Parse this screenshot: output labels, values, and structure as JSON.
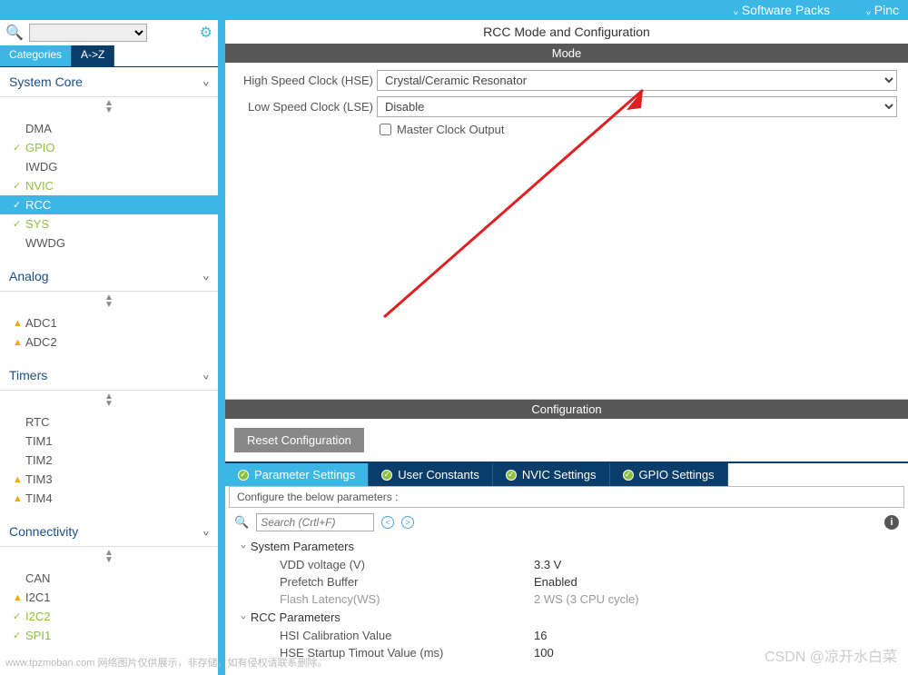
{
  "topbar": {
    "item1": "Software Packs",
    "item2": "Pinc"
  },
  "leftTabs": {
    "categories": "Categories",
    "az": "A->Z"
  },
  "search": {
    "placeholder": ""
  },
  "groups": [
    {
      "name": "System Core",
      "items": [
        {
          "label": "DMA",
          "state": ""
        },
        {
          "label": "GPIO",
          "state": "green"
        },
        {
          "label": "IWDG",
          "state": ""
        },
        {
          "label": "NVIC",
          "state": "green"
        },
        {
          "label": "RCC",
          "state": "green",
          "selected": true
        },
        {
          "label": "SYS",
          "state": "green"
        },
        {
          "label": "WWDG",
          "state": ""
        }
      ]
    },
    {
      "name": "Analog",
      "items": [
        {
          "label": "ADC1",
          "state": "warn"
        },
        {
          "label": "ADC2",
          "state": "warn"
        }
      ]
    },
    {
      "name": "Timers",
      "items": [
        {
          "label": "RTC",
          "state": ""
        },
        {
          "label": "TIM1",
          "state": ""
        },
        {
          "label": "TIM2",
          "state": ""
        },
        {
          "label": "TIM3",
          "state": "warn"
        },
        {
          "label": "TIM4",
          "state": "warn"
        }
      ]
    },
    {
      "name": "Connectivity",
      "items": [
        {
          "label": "CAN",
          "state": ""
        },
        {
          "label": "I2C1",
          "state": "warn"
        },
        {
          "label": "I2C2",
          "state": "green"
        },
        {
          "label": "SPI1",
          "state": "green"
        }
      ]
    }
  ],
  "rightTitle": "RCC Mode and Configuration",
  "modeBar": "Mode",
  "form": {
    "hse_label": "High Speed Clock (HSE)",
    "hse_value": "Crystal/Ceramic Resonator",
    "lse_label": "Low Speed Clock (LSE)",
    "lse_value": "Disable",
    "mco_label": "Master Clock Output"
  },
  "configBar": "Configuration",
  "resetBtn": "Reset Configuration",
  "subtabs": {
    "t1": "Parameter Settings",
    "t2": "User Constants",
    "t3": "NVIC Settings",
    "t4": "GPIO Settings"
  },
  "cfgHint": "Configure the below parameters :",
  "paramSearch": {
    "placeholder": "Search (Crtl+F)"
  },
  "paramsGroups": [
    {
      "title": "System Parameters",
      "rows": [
        {
          "label": "VDD voltage (V)",
          "value": "3.3 V"
        },
        {
          "label": "Prefetch Buffer",
          "value": "Enabled"
        },
        {
          "label": "Flash Latency(WS)",
          "value": "2 WS (3 CPU cycle)",
          "gray": true
        }
      ]
    },
    {
      "title": "RCC Parameters",
      "rows": [
        {
          "label": "HSI Calibration Value",
          "value": "16"
        },
        {
          "label": "HSE Startup Timout Value (ms)",
          "value": "100"
        }
      ]
    }
  ],
  "watermark1": "www.tpzmoban.com   网络图片仅供展示，非存储，如有侵权请联系删除。",
  "watermark2": "CSDN @凉开水白菜"
}
